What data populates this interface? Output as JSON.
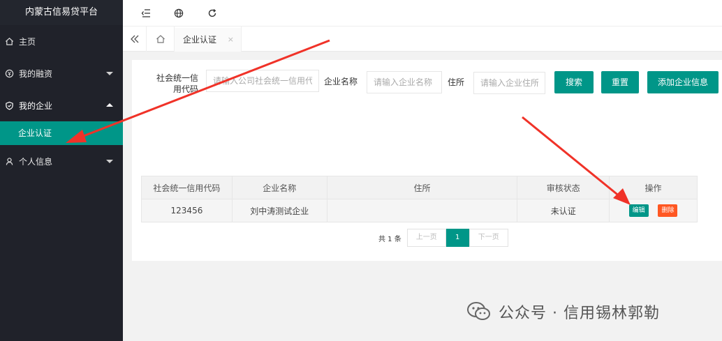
{
  "sidebar": {
    "brand": "内蒙古信易贷平台",
    "items": [
      {
        "label": "主页",
        "icon": "home-icon"
      },
      {
        "label": "我的融资",
        "icon": "money-icon"
      },
      {
        "label": "我的企业",
        "icon": "shield-icon"
      },
      {
        "label": "个人信息",
        "icon": "user-icon"
      }
    ],
    "sub_active": "企业认证"
  },
  "header": {
    "icons": [
      "shrink-menu-icon",
      "globe-icon",
      "refresh-icon"
    ]
  },
  "tabs": {
    "current": "企业认证",
    "close": "×"
  },
  "search": {
    "credit_code_label": "社会统一信用代码",
    "credit_code_placeholder": "请输入公司社会统一信用代码",
    "name_label": "企业名称",
    "name_placeholder": "请输入企业名称",
    "address_label": "住所",
    "address_placeholder": "请输入企业住所",
    "search_btn": "搜索",
    "reset_btn": "重置",
    "add_btn": "添加企业信息"
  },
  "table": {
    "headers": [
      "社会统一信用代码",
      "企业名称",
      "住所",
      "审核状态",
      "操作"
    ],
    "rows": [
      {
        "code": "123456",
        "name": "刘中涛测试企业",
        "address": "",
        "status": "未认证",
        "edit": "编辑",
        "delete": "删除"
      }
    ]
  },
  "pagination": {
    "total": "共 1 条",
    "prev": "上一页",
    "current": "1",
    "next": "下一页"
  },
  "watermark": {
    "text": "公众号 · 信用锡林郭勒"
  },
  "colors": {
    "accent": "#009688",
    "danger": "#ff5722",
    "sidebar_bg": "#20222a",
    "arrow": "#f03228"
  }
}
